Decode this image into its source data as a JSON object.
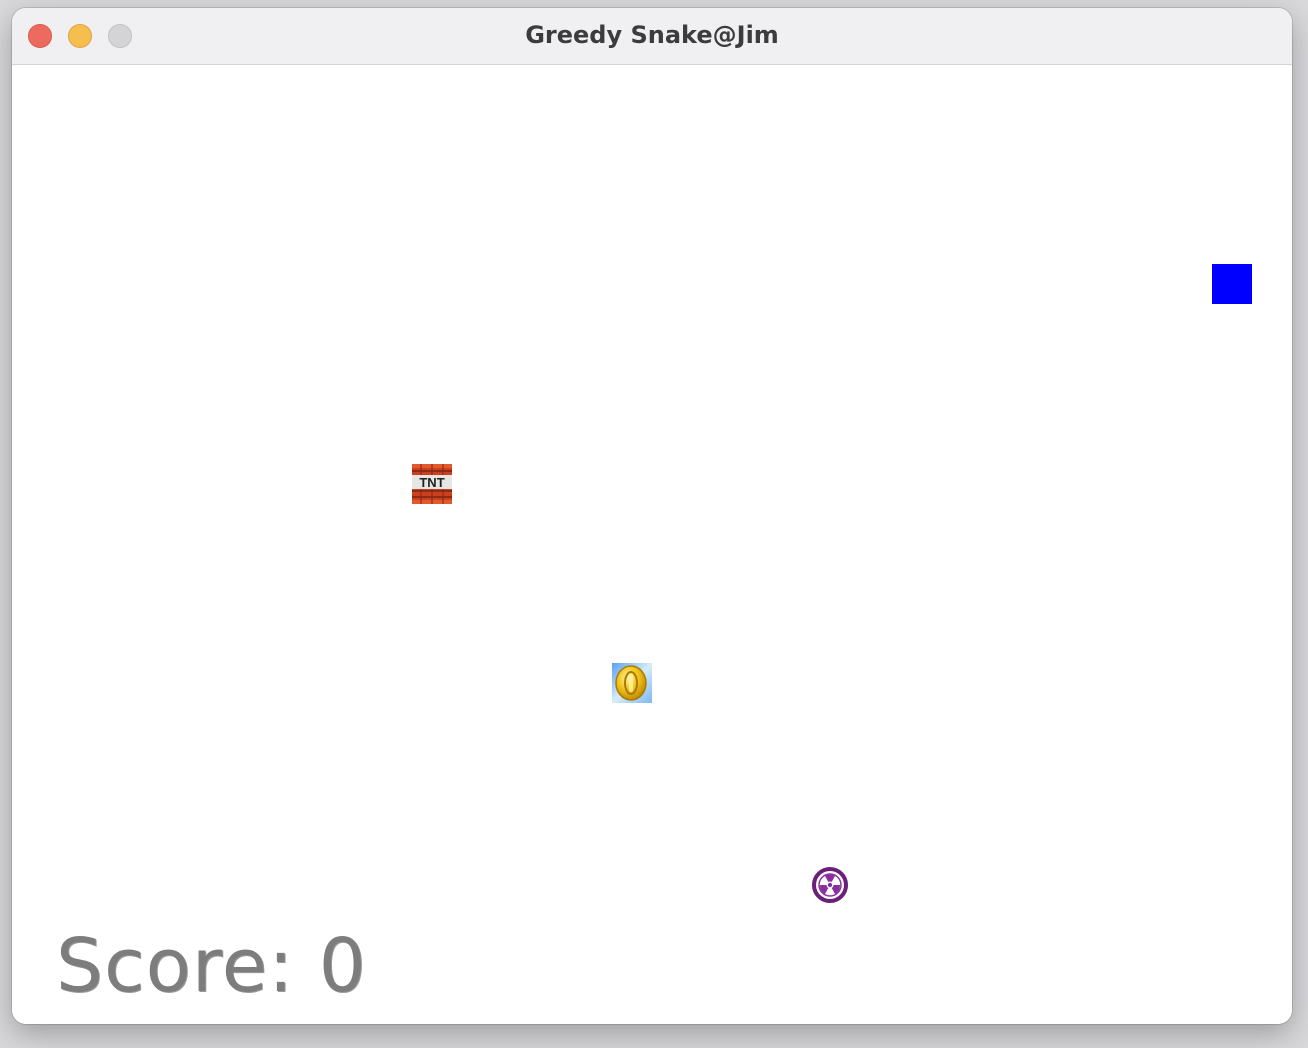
{
  "window": {
    "title": "Greedy Snake@Jim"
  },
  "game": {
    "score_label": "Score:",
    "score_value": "0",
    "tnt_label": "TNT",
    "items": [
      {
        "type": "snake-head",
        "color": "#0000ff"
      },
      {
        "type": "tnt-block",
        "icon": "tnt-icon"
      },
      {
        "type": "coin",
        "icon": "coin-icon"
      },
      {
        "type": "hazard",
        "icon": "radiation-icon"
      }
    ]
  },
  "colors": {
    "snake": "#0000ff",
    "score_text": "#7d7d7d",
    "close_button": "#ed6a5e",
    "minimize_button": "#f5be4f",
    "zoom_button": "#d4d4d6"
  }
}
